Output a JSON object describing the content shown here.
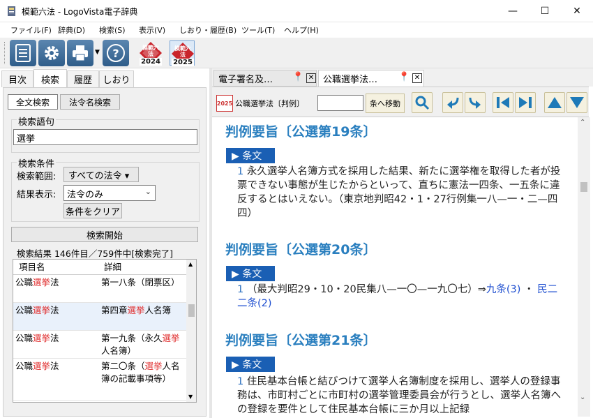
{
  "window": {
    "title": "模範六法 - LogoVista電子辞典",
    "minimize": "—",
    "maximize": "☐",
    "close": "✕"
  },
  "menu": [
    "ファイル(F)",
    "辞典(D)",
    "検索(S)",
    "表示(V)",
    "しおり・履歴(B)",
    "ツール(T)",
    "ヘルプ(H)"
  ],
  "toolbar": {
    "book1_year": "2024",
    "book2_year": "2025",
    "book_label": "模範六法",
    "help_glyph": "?"
  },
  "left_tabs": [
    "目次",
    "検索",
    "履歴",
    "しおり"
  ],
  "search": {
    "mode_fulltext": "全文検索",
    "mode_lawname": "法令名検索",
    "term_label": "検索語句",
    "term_value": "選挙",
    "conditions_label": "検索条件",
    "scope_label": "検索範囲:",
    "scope_value": "すべての法令 ▾",
    "display_label": "結果表示:",
    "display_value": "法令のみ",
    "clear_button": "条件をクリア",
    "start_button": "検索開始",
    "results_status": "検索結果 146件目／759件中[検索完了]"
  },
  "results": {
    "headers": [
      "項目名",
      "詳細"
    ],
    "rows": [
      {
        "c1a": "公職",
        "c1b": "選挙",
        "c1c": "法",
        "c2": "第一八条（閉票区）"
      },
      {
        "c1a": "公職",
        "c1b": "選挙",
        "c1c": "法",
        "c2a": "第四章",
        "c2b": "選挙",
        "c2c": "人名簿"
      },
      {
        "c1a": "公職",
        "c1b": "選挙",
        "c1c": "法",
        "c2a": "第一九条（永久",
        "c2b": "選挙",
        "c2c": "人名簿）"
      },
      {
        "c1a": "公職",
        "c1b": "選挙",
        "c1c": "法",
        "c2a": "第二〇条（",
        "c2b": "選挙",
        "c2c": "人名簿の記載事項等）"
      }
    ]
  },
  "right_tabs": [
    {
      "label": "電子署名及…"
    },
    {
      "label": "公職選挙法…"
    }
  ],
  "doc_toolbar": {
    "icon_year": "2025",
    "law_name": "公職選挙法〔判例〕",
    "jump_input": "",
    "jump_button": "条へ移動"
  },
  "content": [
    {
      "heading": "判例要旨〔公選第19条〕",
      "jobun": "▶ 条文",
      "num": "1",
      "text": "永久選挙人名簿方式を採用した結果、新たに選挙権を取得した者が投票できない事態が生じたからといって、直ちに憲法一四条、一五条に違反するとはいえない。（東京地判昭42・1・27行例集一八—一・二—四四）"
    },
    {
      "heading": "判例要旨〔公選第20条〕",
      "jobun": "▶ 条文",
      "num": "1",
      "text": "（最大判昭29・10・20民集八—一〇—一九〇七）⇒",
      "link1": "九条(3)",
      "sep": "・",
      "link2": "民二二条(2)"
    },
    {
      "heading": "判例要旨〔公選第21条〕",
      "jobun": "▶ 条文",
      "num": "1",
      "text": "住民基本台帳と結びつけて選挙人名簿制度を採用し、選挙人の登録事務は、市町村ごとに市町村の選挙管理委員会が行うとし、選挙人名簿への登録を要件として住民基本台帳に三か月以上記録"
    }
  ]
}
